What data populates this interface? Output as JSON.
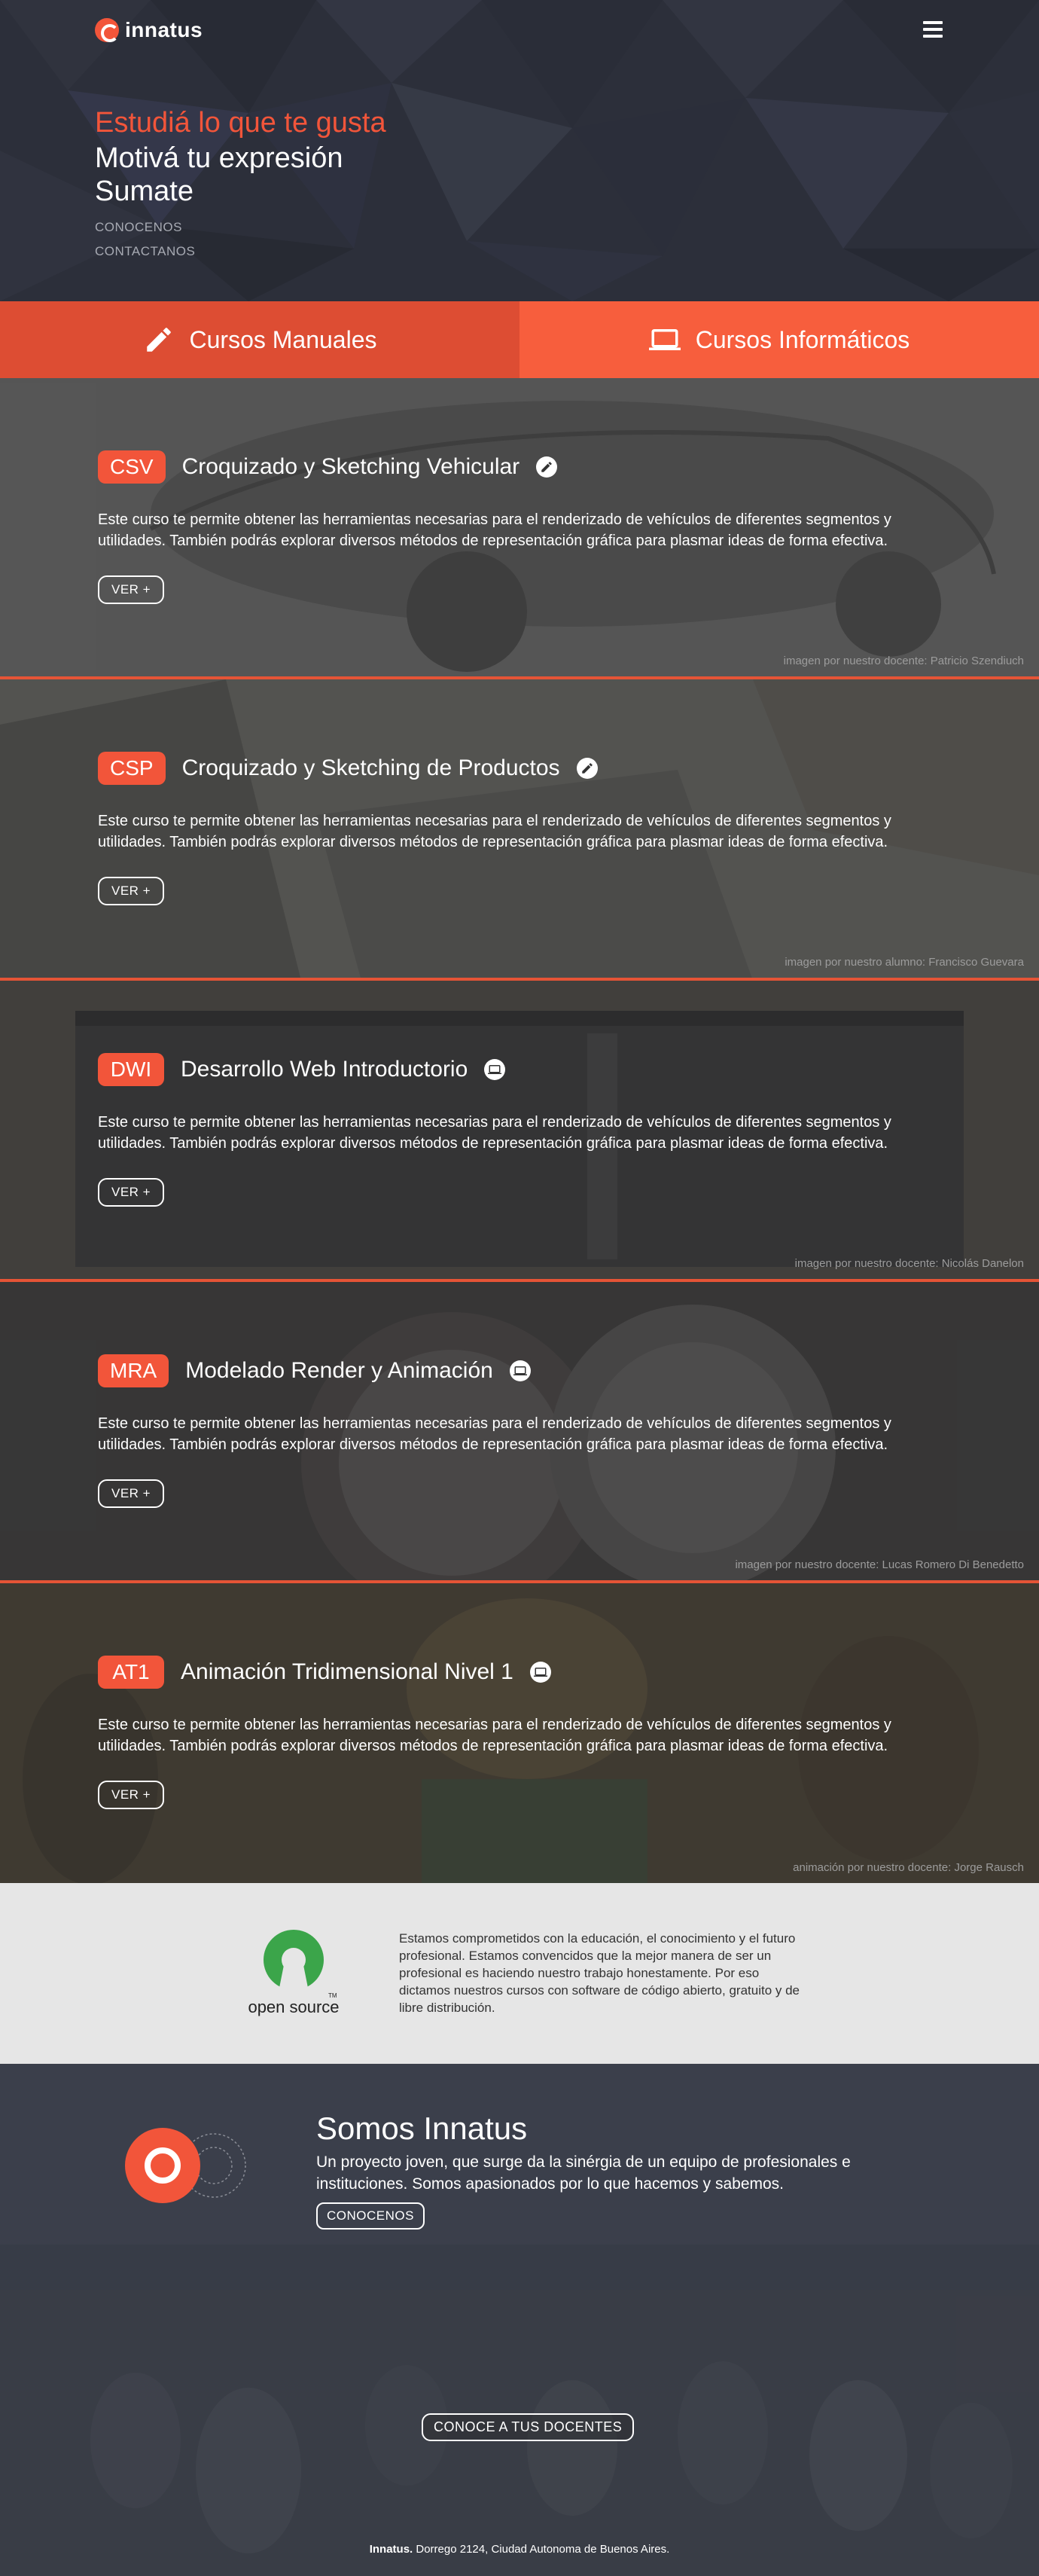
{
  "header": {
    "logo_text": "innatus",
    "menu_icon": "hamburger-menu-icon"
  },
  "hero": {
    "line1": "Estudiá lo que te gusta",
    "line2": "Motivá tu expresión",
    "line3": "Sumate",
    "links": [
      "CONOCENOS",
      "CONTACTANOS"
    ]
  },
  "tabs": [
    {
      "label": "Cursos Manuales",
      "icon": "pencil-icon",
      "color": "#dd4d33"
    },
    {
      "label": "Cursos Informáticos",
      "icon": "laptop-icon",
      "color": "#f75e3d"
    }
  ],
  "courses": [
    {
      "code": "CSV",
      "title": "Croquizado y Sketching Vehicular",
      "icon": "pencil-icon",
      "description": "Este curso te permite obtener las herramientas necesarias para el renderizado de vehículos de diferentes segmentos y utilidades. También podrás explorar diversos métodos de representación gráfica para plasmar ideas de forma efectiva.",
      "button": "VER +",
      "credit": "imagen por nuestro docente: Patricio Szendiuch"
    },
    {
      "code": "CSP",
      "title": "Croquizado y Sketching de Productos",
      "icon": "pencil-icon",
      "description": "Este curso te permite obtener las herramientas necesarias para el renderizado de vehículos de diferentes segmentos y utilidades. También podrás explorar diversos métodos de representación gráfica para plasmar ideas de forma efectiva.",
      "button": "VER +",
      "credit": "imagen por nuestro alumno: Francisco Guevara"
    },
    {
      "code": "DWI",
      "title": "Desarrollo Web Introductorio",
      "icon": "laptop-icon",
      "description": "Este curso te permite obtener las herramientas necesarias para el renderizado de vehículos de diferentes segmentos y utilidades. También podrás explorar diversos métodos de representación gráfica para plasmar ideas de forma efectiva.",
      "button": "VER +",
      "credit": "imagen por nuestro docente: Nicolás Danelon"
    },
    {
      "code": "MRA",
      "title": "Modelado Render y Animación",
      "icon": "laptop-icon",
      "description": "Este curso te permite obtener las herramientas necesarias para el renderizado de vehículos de diferentes segmentos y utilidades. También podrás explorar diversos métodos de representación gráfica para plasmar ideas de forma efectiva.",
      "button": "VER +",
      "credit": "imagen por nuestro docente: Lucas Romero Di Benedetto"
    },
    {
      "code": "AT1",
      "title": "Animación Tridimensional Nivel 1",
      "icon": "laptop-icon",
      "description": "Este curso te permite obtener las herramientas necesarias para el renderizado de vehículos de diferentes segmentos y utilidades. También podrás explorar diversos métodos de representación gráfica para plasmar ideas de forma efectiva.",
      "button": "VER +",
      "credit": "animación por nuestro docente: Jorge Rausch"
    }
  ],
  "opensource": {
    "logo_text": "open source",
    "tm": "TM",
    "text": "Estamos comprometidos con la educación, el conocimiento y el futuro profesional. Estamos convencidos que la mejor manera de ser un profesional es haciendo nuestro trabajo honestamente. Por eso dictamos nuestros cursos con software de código abierto, gratuito y de libre distribución."
  },
  "about": {
    "title": "Somos Innatus",
    "description": "Un proyecto joven, que surge da la sinérgia de un equipo de profesionales e instituciones. Somos apasionados por lo que hacemos y sabemos.",
    "button": "CONOCENOS",
    "docentes_button": "CONOCE A TUS DOCENTES"
  },
  "footer": {
    "brand": "Innatus.",
    "address": " Dorrego 2124, Ciudad Autonoma de Buenos Aires."
  },
  "colors": {
    "accent": "#f2553a",
    "hero_bg": "#2c2f3a",
    "about_bg": "#3b3f4b",
    "oss_bg": "#e6e6e6"
  }
}
